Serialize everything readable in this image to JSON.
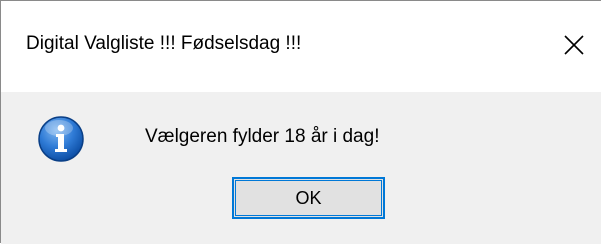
{
  "dialog": {
    "title": "Digital Valgliste !!! Fødselsdag !!!",
    "message": "Vælgeren fylder 18 år i dag!",
    "ok_label": "OK",
    "icon": "info-icon",
    "close_icon": "close-icon"
  },
  "colors": {
    "accent": "#0078d7",
    "content_background": "#f0f0f0",
    "button_face": "#e1e1e1"
  }
}
